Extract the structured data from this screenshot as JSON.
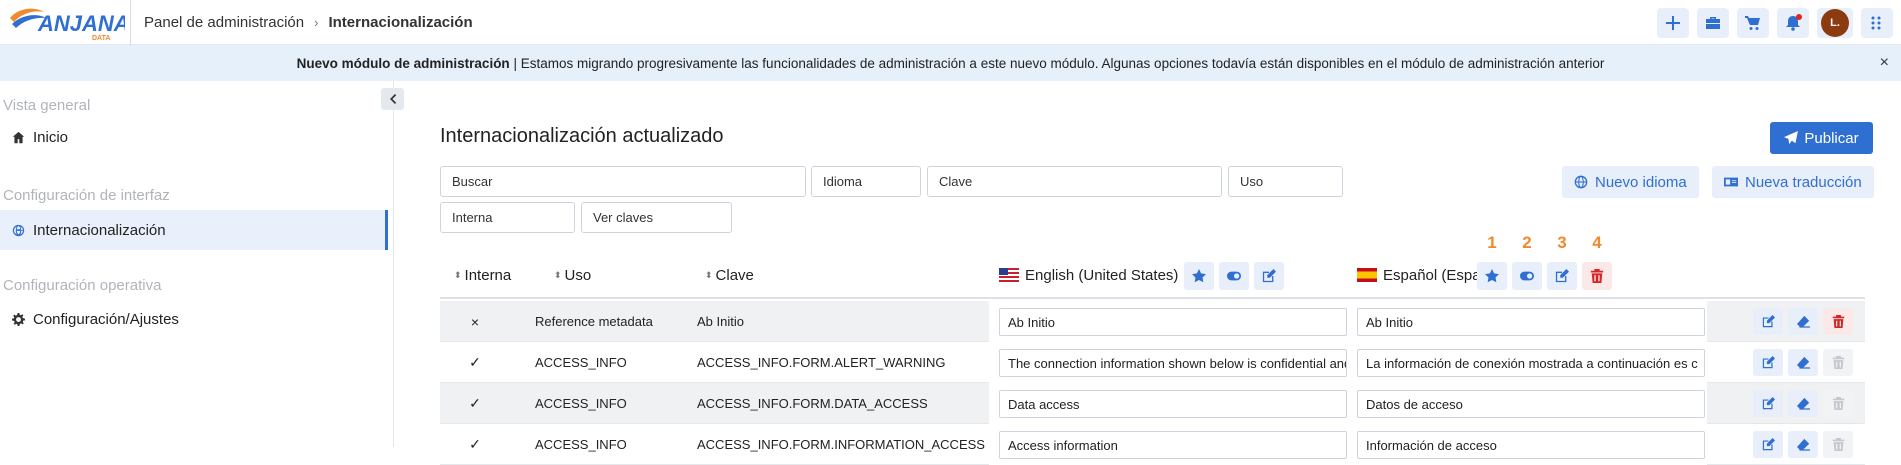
{
  "brand": {
    "name": "ANJANA",
    "sub": "DATA"
  },
  "breadcrumb": {
    "root": "Panel de administración",
    "separator": "›",
    "current": "Internacionalización"
  },
  "colors": {
    "accent": "#2f6fd1",
    "danger": "#d62525",
    "banner_bg": "#e6f0fb",
    "marker": "#f08a2c"
  },
  "banner": {
    "bold": "Nuevo módulo de administración",
    "text": " | Estamos migrando progresivamente las funcionalidades de administración a este nuevo módulo. Algunas opciones todavía están disponibles en el  módulo de administración anterior",
    "close": "×"
  },
  "avatar": {
    "initial": "L."
  },
  "sidebar": {
    "sections": [
      {
        "title": "Vista general",
        "items": [
          {
            "label": "Inicio",
            "icon": "home-icon"
          }
        ]
      },
      {
        "title": "Configuración de interfaz",
        "items": [
          {
            "label": "Internacionalización",
            "icon": "globe-icon",
            "active": true
          }
        ]
      },
      {
        "title": "Configuración operativa",
        "items": [
          {
            "label": "Configuración/Ajustes",
            "icon": "gear-icon"
          }
        ]
      }
    ]
  },
  "main": {
    "title": "Internacionalización actualizado",
    "publish_label": "Publicar",
    "filters": {
      "buscar": "Buscar",
      "idioma": "Idioma",
      "clave": "Clave",
      "uso": "Uso",
      "interna": "Interna",
      "ver_claves": "Ver claves"
    },
    "new_language_label": "Nuevo idioma",
    "new_translation_label": "Nueva traducción"
  },
  "table": {
    "headers": {
      "interna": "Interna",
      "uso": "Uso",
      "clave": "Clave",
      "en": "English (United States)",
      "es": "Español (España)"
    },
    "markers": [
      "1",
      "2",
      "3",
      "4"
    ],
    "rows": [
      {
        "interna": "×",
        "uso": "Reference metadata",
        "clave": "Ab Initio",
        "en": "Ab Initio",
        "es": "Ab Initio",
        "delete_enabled": true
      },
      {
        "interna": "✓",
        "uso": "ACCESS_INFO",
        "clave": "ACCESS_INFO.FORM.ALERT_WARNING",
        "en": "The connection information shown below is confidential and",
        "es": "La información de conexión mostrada a continuación es c",
        "delete_enabled": false
      },
      {
        "interna": "✓",
        "uso": "ACCESS_INFO",
        "clave": "ACCESS_INFO.FORM.DATA_ACCESS",
        "en": "Data access",
        "es": "Datos de acceso",
        "delete_enabled": false
      },
      {
        "interna": "✓",
        "uso": "ACCESS_INFO",
        "clave": "ACCESS_INFO.FORM.INFORMATION_ACCESS",
        "en": "Access information",
        "es": "Información de acceso",
        "delete_enabled": false
      }
    ]
  }
}
